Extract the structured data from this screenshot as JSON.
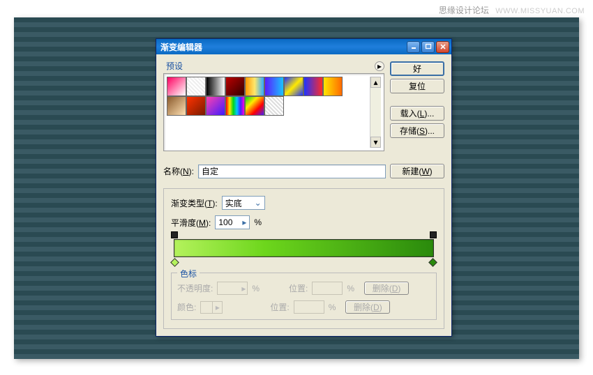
{
  "watermark": {
    "text": "思缘设计论坛",
    "site": "WWW.MISSYUAN.COM"
  },
  "dialog": {
    "title": "渐变编辑器",
    "presets_label": "预设",
    "buttons": {
      "ok": "好",
      "reset": "复位",
      "load": "载入(L)...",
      "save": "存储(S)..."
    },
    "name_label": "名称(N):",
    "name_value": "自定",
    "new_btn": "新建(W)",
    "type_label": "渐变类型(T):",
    "type_value": "实底",
    "smooth_label": "平滑度(M):",
    "smooth_value": "100",
    "smooth_suffix": "%",
    "stops": {
      "legend": "色标",
      "opacity_label": "不透明度:",
      "opacity_suffix": "%",
      "position1_label": "位置:",
      "position1_suffix": "%",
      "delete1": "删除(D)",
      "color_label": "颜色:",
      "position2_label": "位置:",
      "position2_suffix": "%",
      "delete2": "删除(D)"
    },
    "gradient": {
      "start_color": "#b4f25c",
      "end_color": "#2a8a0c"
    },
    "swatches": [
      "linear-gradient(135deg,#ff0060,#fff)",
      "repeating-linear-gradient(45deg,#eee,#eee 2px,#fff 2px,#fff 4px)",
      "linear-gradient(90deg,#000,#fff)",
      "linear-gradient(135deg,#b00,#300)",
      "linear-gradient(90deg,#ff9a00,#ffe76b,#2ea9ff)",
      "linear-gradient(90deg,#5a1bff,#19c3ff)",
      "linear-gradient(135deg,#1e33ff,#ffea00,#1e33ff)",
      "linear-gradient(90deg,#1e33ff,#ff2a2a)",
      "linear-gradient(90deg,#ffe600,#ff6a00)",
      "linear-gradient(135deg,#8a5a2c,#ffe1b3)",
      "linear-gradient(135deg,#ff3200,#7a1b00)",
      "linear-gradient(135deg,#ff41b0,#3e1bff)",
      "linear-gradient(90deg,#ff0000,#ffea00,#00d619,#00c7ff,#4320ff,#ff00e0)",
      "linear-gradient(135deg,#00d619,#ffea00,#ff0000,#4320ff)",
      "repeating-linear-gradient(45deg,#ddd,#ddd 2px,#fff 2px,#fff 4px)"
    ]
  }
}
